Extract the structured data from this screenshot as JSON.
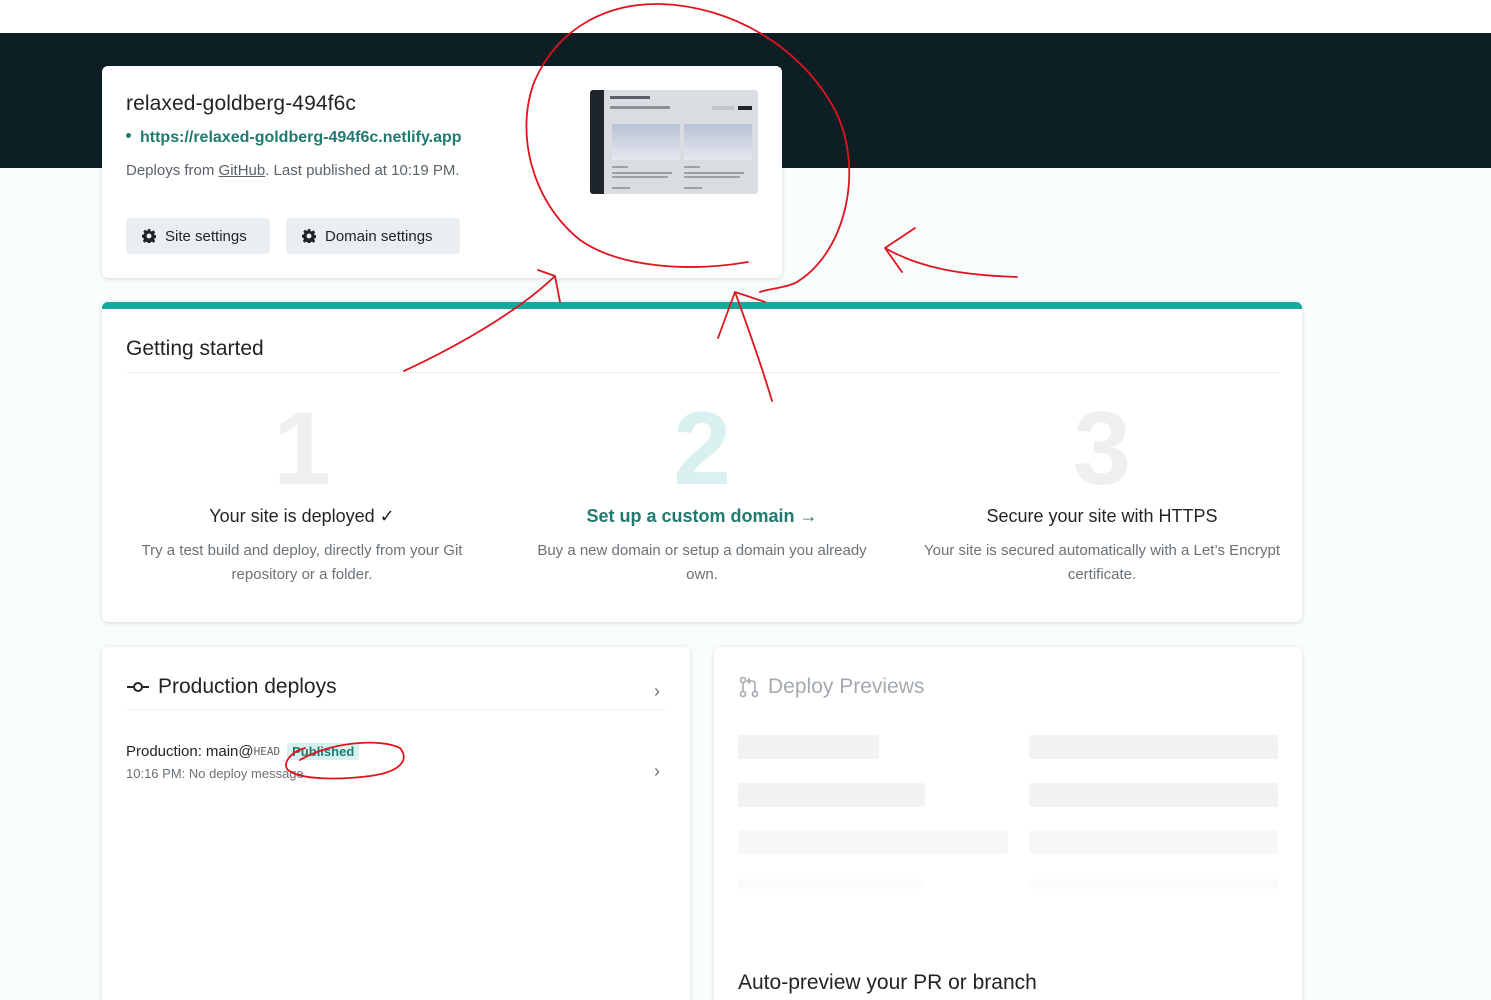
{
  "site": {
    "name": "relaxed-goldberg-494f6c",
    "url": "https://relaxed-goldberg-494f6c.netlify.app",
    "deploy_prefix": "Deploys from ",
    "deploy_source": "GitHub",
    "deploy_suffix": ". Last published at 10:19 PM.",
    "buttons": {
      "site_settings": "Site settings",
      "domain_settings": "Domain settings"
    }
  },
  "getting_started": {
    "title": "Getting started",
    "steps": [
      {
        "number": "1",
        "title": "Your site is deployed ✓",
        "description": "Try a test build and deploy, directly from your Git repository or a folder."
      },
      {
        "number": "2",
        "title": "Set up a custom domain →",
        "description": "Buy a new domain or setup a domain you already own."
      },
      {
        "number": "3",
        "title": "Secure your site with HTTPS",
        "description": "Your site is secured automatically with a Let’s Encrypt certificate."
      }
    ]
  },
  "production_deploys": {
    "title": "Production deploys",
    "deploy": {
      "label": "Production:",
      "branch": "main@",
      "ref": "HEAD",
      "badge": "Published",
      "meta": "10:16 PM: No deploy message"
    }
  },
  "deploy_previews": {
    "title": "Deploy Previews",
    "subtitle": "Auto-preview your PR or branch"
  },
  "colors": {
    "accent": "#15a99b",
    "link": "#1f7a6f",
    "hero": "#0e1e25",
    "annotation": "#e0141e"
  },
  "icons": {
    "settings": "gear-icon",
    "commit": "commit-icon",
    "pull_request": "pull-request-icon",
    "chevron": "chevron-right-icon"
  }
}
